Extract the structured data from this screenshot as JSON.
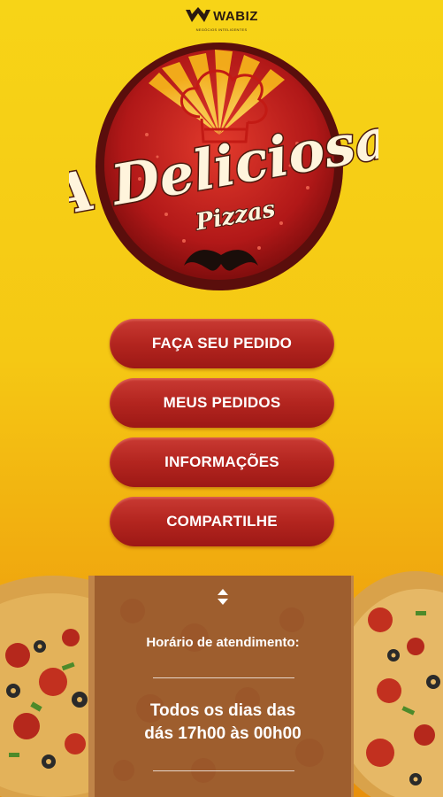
{
  "brand": {
    "name": "WABIZ",
    "tagline": "NEGÓCIOS INTELIGENTES"
  },
  "logo": {
    "title": "A Deliciosa",
    "subtitle": "Pizzas"
  },
  "menu": {
    "items": [
      {
        "label": "FAÇA SEU PEDIDO"
      },
      {
        "label": "MEUS PEDIDOS"
      },
      {
        "label": "INFORMAÇÕES"
      },
      {
        "label": "COMPARTILHE"
      }
    ]
  },
  "hours": {
    "label": "Horário de atendimento:",
    "line1": "Todos os dias das",
    "line2": "dás 17h00 às 00h00"
  },
  "colors": {
    "background": "#f5c814",
    "button": "#b3251f",
    "panel": "#965528",
    "logo_ring": "#5a0e0c"
  }
}
